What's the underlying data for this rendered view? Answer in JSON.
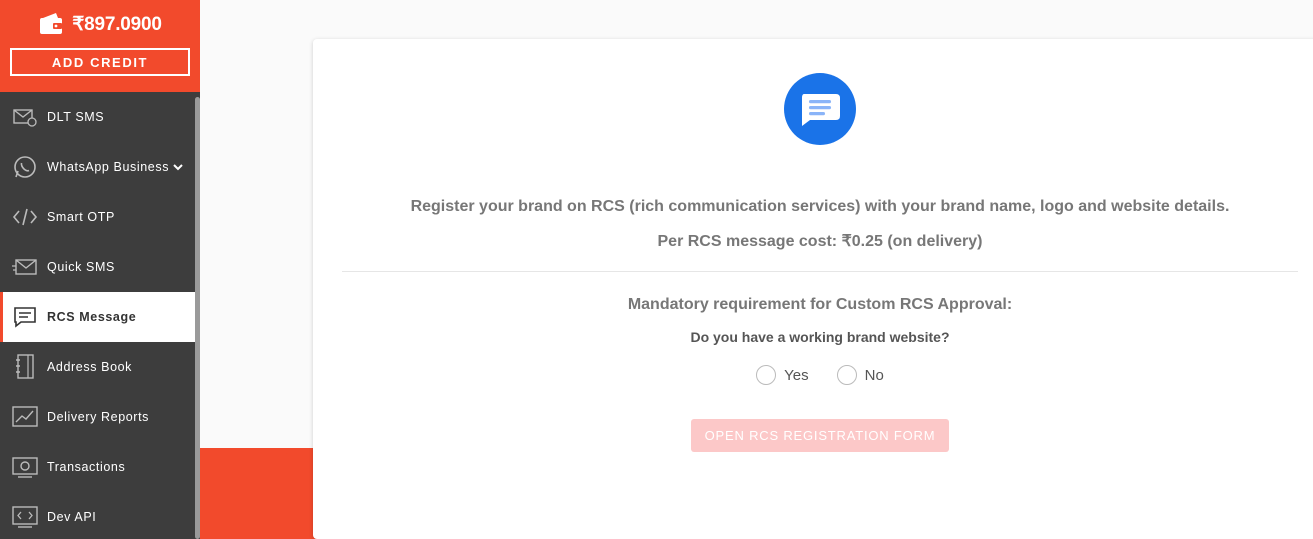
{
  "wallet": {
    "balance": "₹897.0900",
    "add_credit_label": "ADD CREDIT"
  },
  "sidebar": {
    "items": [
      {
        "label": "DLT SMS",
        "icon": "mail-settings-icon"
      },
      {
        "label": "WhatsApp Business",
        "icon": "whatsapp-icon",
        "has_submenu": true
      },
      {
        "label": "Smart OTP",
        "icon": "code-icon"
      },
      {
        "label": "Quick SMS",
        "icon": "envelope-fast-icon"
      },
      {
        "label": "RCS Message",
        "icon": "chat-message-icon",
        "active": true
      },
      {
        "label": "Address Book",
        "icon": "address-book-icon"
      },
      {
        "label": "Delivery Reports",
        "icon": "chart-icon"
      },
      {
        "label": "Transactions",
        "icon": "transactions-icon"
      },
      {
        "label": "Dev API",
        "icon": "dev-api-icon"
      }
    ]
  },
  "main": {
    "headline": "Register your brand on RCS (rich communication services) with your brand name, logo and website details.",
    "cost_text": "Per RCS message cost: ₹0.25 (on delivery)",
    "requirement_title": "Mandatory requirement for Custom RCS Approval:",
    "question": "Do you have a working brand website?",
    "options": [
      "Yes",
      "No"
    ],
    "open_form_label": "OPEN RCS REGISTRATION FORM"
  },
  "colors": {
    "accent": "#f24a2c",
    "sidebar_bg": "#3d3d3d",
    "rcs_blue": "#1a73e8",
    "button_disabled": "#fcc8c8"
  }
}
